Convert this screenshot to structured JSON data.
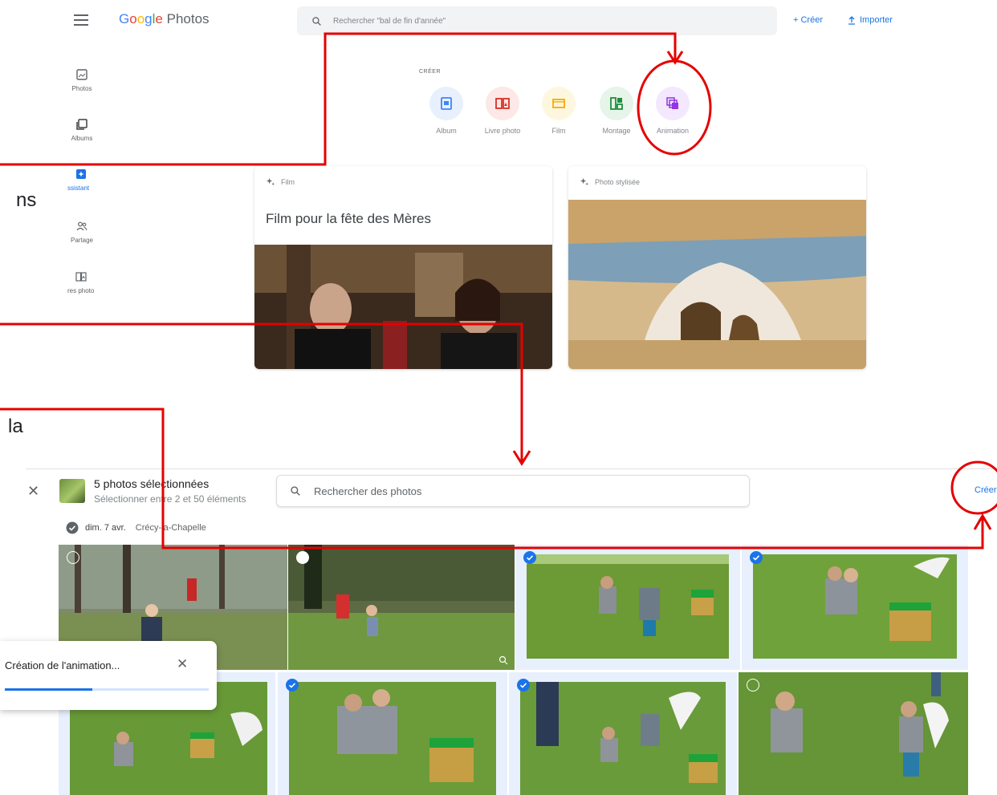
{
  "header": {
    "logo_brand": "Google",
    "logo_product": "Photos",
    "search_placeholder": "Rechercher \"bal de fin d'année\"",
    "create_label": "+ Créer",
    "import_label": "Importer"
  },
  "sidebar": {
    "items": [
      {
        "label": "Photos",
        "icon": "photo-icon"
      },
      {
        "label": "Albums",
        "icon": "albums-icon"
      },
      {
        "label": "ssistant",
        "icon": "assistant-icon"
      },
      {
        "label": "Partage",
        "icon": "sharing-icon"
      },
      {
        "label": "res photo",
        "icon": "photobook-icon"
      }
    ]
  },
  "create_section": {
    "heading": "CRÉER",
    "buttons": [
      {
        "label": "Album",
        "icon": "album-icon",
        "bg": "#e8f0fe",
        "fg": "#4285f4"
      },
      {
        "label": "Livre photo",
        "icon": "photobook-icon",
        "bg": "#fce8e6",
        "fg": "#d93025"
      },
      {
        "label": "Film",
        "icon": "film-icon",
        "bg": "#fef7e0",
        "fg": "#f9ab00"
      },
      {
        "label": "Montage",
        "icon": "collage-icon",
        "bg": "#e6f4ea",
        "fg": "#1e8e3e"
      },
      {
        "label": "Animation",
        "icon": "animation-icon",
        "bg": "#f3e8fd",
        "fg": "#9334e6"
      }
    ]
  },
  "cards": [
    {
      "type": "Film",
      "title": "Film pour la fête des Mères"
    },
    {
      "type": "Photo stylisée",
      "title": ""
    }
  ],
  "clipped_text": {
    "first": "ns",
    "second": "la"
  },
  "selection": {
    "title": "5 photos sélectionnées",
    "subtitle": "Sélectionner entre 2 et 50 éléments",
    "search_placeholder": "Rechercher des photos",
    "create_label": "Créer",
    "date": "dim. 7 avr.",
    "location": "Crécy-la-Chapelle"
  },
  "toast": {
    "text": "Création de l'animation...",
    "progress": 0.43
  },
  "colors": {
    "accent": "#1a73e8",
    "annotation": "#e60000"
  }
}
